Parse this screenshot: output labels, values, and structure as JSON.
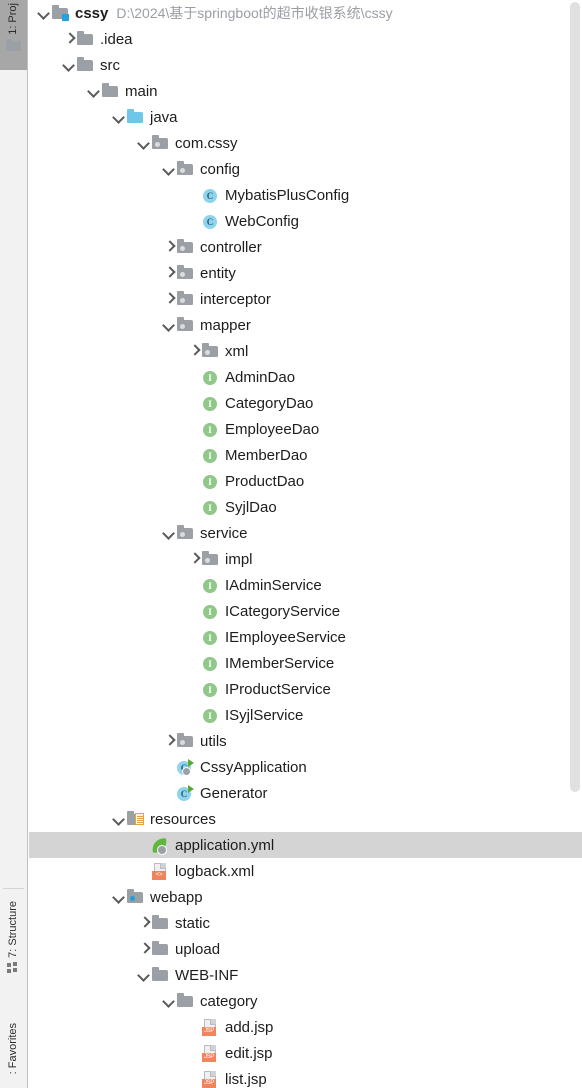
{
  "toolwindow_stripe": {
    "tabs": [
      {
        "id": "project",
        "label": "1: Proj",
        "icon": "folder-icon",
        "active": true
      },
      {
        "id": "structure",
        "label": "7: Structure",
        "icon": "structure-icon",
        "active": false
      },
      {
        "id": "favorites",
        "label": ": Favorites",
        "icon": "favorites-icon",
        "active": false
      }
    ]
  },
  "tree": {
    "rows": [
      {
        "indent": 0,
        "arrow": "expanded",
        "icon": "project-root-folder-icon",
        "label": "cssy",
        "bold": true,
        "path": "D:\\2024\\基于springboot的超市收银系统\\cssy",
        "selected": false
      },
      {
        "indent": 1,
        "arrow": "collapsed",
        "icon": "folder-icon",
        "label": ".idea",
        "selected": false
      },
      {
        "indent": 1,
        "arrow": "expanded",
        "icon": "folder-icon",
        "label": "src",
        "selected": false
      },
      {
        "indent": 2,
        "arrow": "expanded",
        "icon": "folder-icon",
        "label": "main",
        "selected": false
      },
      {
        "indent": 3,
        "arrow": "expanded",
        "icon": "java-source-root-folder-icon",
        "label": "java",
        "selected": false
      },
      {
        "indent": 4,
        "arrow": "expanded",
        "icon": "package-folder-icon",
        "label": "com.cssy",
        "selected": false
      },
      {
        "indent": 5,
        "arrow": "expanded",
        "icon": "package-folder-icon",
        "label": "config",
        "selected": false
      },
      {
        "indent": 6,
        "arrow": "none",
        "icon": "java-class-icon",
        "label": "MybatisPlusConfig",
        "selected": false
      },
      {
        "indent": 6,
        "arrow": "none",
        "icon": "java-class-icon",
        "label": "WebConfig",
        "selected": false
      },
      {
        "indent": 5,
        "arrow": "collapsed",
        "icon": "package-folder-icon",
        "label": "controller",
        "selected": false
      },
      {
        "indent": 5,
        "arrow": "collapsed",
        "icon": "package-folder-icon",
        "label": "entity",
        "selected": false
      },
      {
        "indent": 5,
        "arrow": "collapsed",
        "icon": "package-folder-icon",
        "label": "interceptor",
        "selected": false
      },
      {
        "indent": 5,
        "arrow": "expanded",
        "icon": "package-folder-icon",
        "label": "mapper",
        "selected": false
      },
      {
        "indent": 6,
        "arrow": "collapsed",
        "icon": "package-folder-icon",
        "label": "xml",
        "selected": false
      },
      {
        "indent": 6,
        "arrow": "none",
        "icon": "java-interface-icon",
        "label": "AdminDao",
        "selected": false
      },
      {
        "indent": 6,
        "arrow": "none",
        "icon": "java-interface-icon",
        "label": "CategoryDao",
        "selected": false
      },
      {
        "indent": 6,
        "arrow": "none",
        "icon": "java-interface-icon",
        "label": "EmployeeDao",
        "selected": false
      },
      {
        "indent": 6,
        "arrow": "none",
        "icon": "java-interface-icon",
        "label": "MemberDao",
        "selected": false
      },
      {
        "indent": 6,
        "arrow": "none",
        "icon": "java-interface-icon",
        "label": "ProductDao",
        "selected": false
      },
      {
        "indent": 6,
        "arrow": "none",
        "icon": "java-interface-icon",
        "label": "SyjlDao",
        "selected": false
      },
      {
        "indent": 5,
        "arrow": "expanded",
        "icon": "package-folder-icon",
        "label": "service",
        "selected": false
      },
      {
        "indent": 6,
        "arrow": "collapsed",
        "icon": "package-folder-icon",
        "label": "impl",
        "selected": false
      },
      {
        "indent": 6,
        "arrow": "none",
        "icon": "java-interface-icon",
        "label": "IAdminService",
        "selected": false
      },
      {
        "indent": 6,
        "arrow": "none",
        "icon": "java-interface-icon",
        "label": "ICategoryService",
        "selected": false
      },
      {
        "indent": 6,
        "arrow": "none",
        "icon": "java-interface-icon",
        "label": "IEmployeeService",
        "selected": false
      },
      {
        "indent": 6,
        "arrow": "none",
        "icon": "java-interface-icon",
        "label": "IMemberService",
        "selected": false
      },
      {
        "indent": 6,
        "arrow": "none",
        "icon": "java-interface-icon",
        "label": "IProductService",
        "selected": false
      },
      {
        "indent": 6,
        "arrow": "none",
        "icon": "java-interface-icon",
        "label": "ISyjlService",
        "selected": false
      },
      {
        "indent": 5,
        "arrow": "collapsed",
        "icon": "package-folder-icon",
        "label": "utils",
        "selected": false
      },
      {
        "indent": 5,
        "arrow": "none",
        "icon": "spring-boot-runnable-class-icon",
        "label": "CssyApplication",
        "selected": false
      },
      {
        "indent": 5,
        "arrow": "none",
        "icon": "runnable-class-icon",
        "label": "Generator",
        "selected": false
      },
      {
        "indent": 3,
        "arrow": "expanded",
        "icon": "resources-root-folder-icon",
        "label": "resources",
        "selected": false
      },
      {
        "indent": 4,
        "arrow": "none",
        "icon": "spring-yaml-icon",
        "label": "application.yml",
        "selected": true
      },
      {
        "indent": 4,
        "arrow": "none",
        "icon": "xml-file-icon",
        "label": "logback.xml",
        "tag": "<>",
        "selected": false
      },
      {
        "indent": 3,
        "arrow": "expanded",
        "icon": "webapp-folder-icon",
        "label": "webapp",
        "selected": false
      },
      {
        "indent": 4,
        "arrow": "collapsed",
        "icon": "folder-icon",
        "label": "static",
        "selected": false
      },
      {
        "indent": 4,
        "arrow": "collapsed",
        "icon": "folder-icon",
        "label": "upload",
        "selected": false
      },
      {
        "indent": 4,
        "arrow": "expanded",
        "icon": "folder-icon",
        "label": "WEB-INF",
        "selected": false
      },
      {
        "indent": 5,
        "arrow": "expanded",
        "icon": "folder-icon",
        "label": "category",
        "selected": false
      },
      {
        "indent": 6,
        "arrow": "none",
        "icon": "jsp-file-icon",
        "label": "add.jsp",
        "tag": "JSP",
        "selected": false
      },
      {
        "indent": 6,
        "arrow": "none",
        "icon": "jsp-file-icon",
        "label": "edit.jsp",
        "tag": "JSP",
        "selected": false
      },
      {
        "indent": 6,
        "arrow": "none",
        "icon": "jsp-file-icon",
        "label": "list.jsp",
        "tag": "JSP",
        "selected": false
      }
    ]
  },
  "scrollbar": {
    "orientation": "vertical",
    "thumb_visible": true
  }
}
